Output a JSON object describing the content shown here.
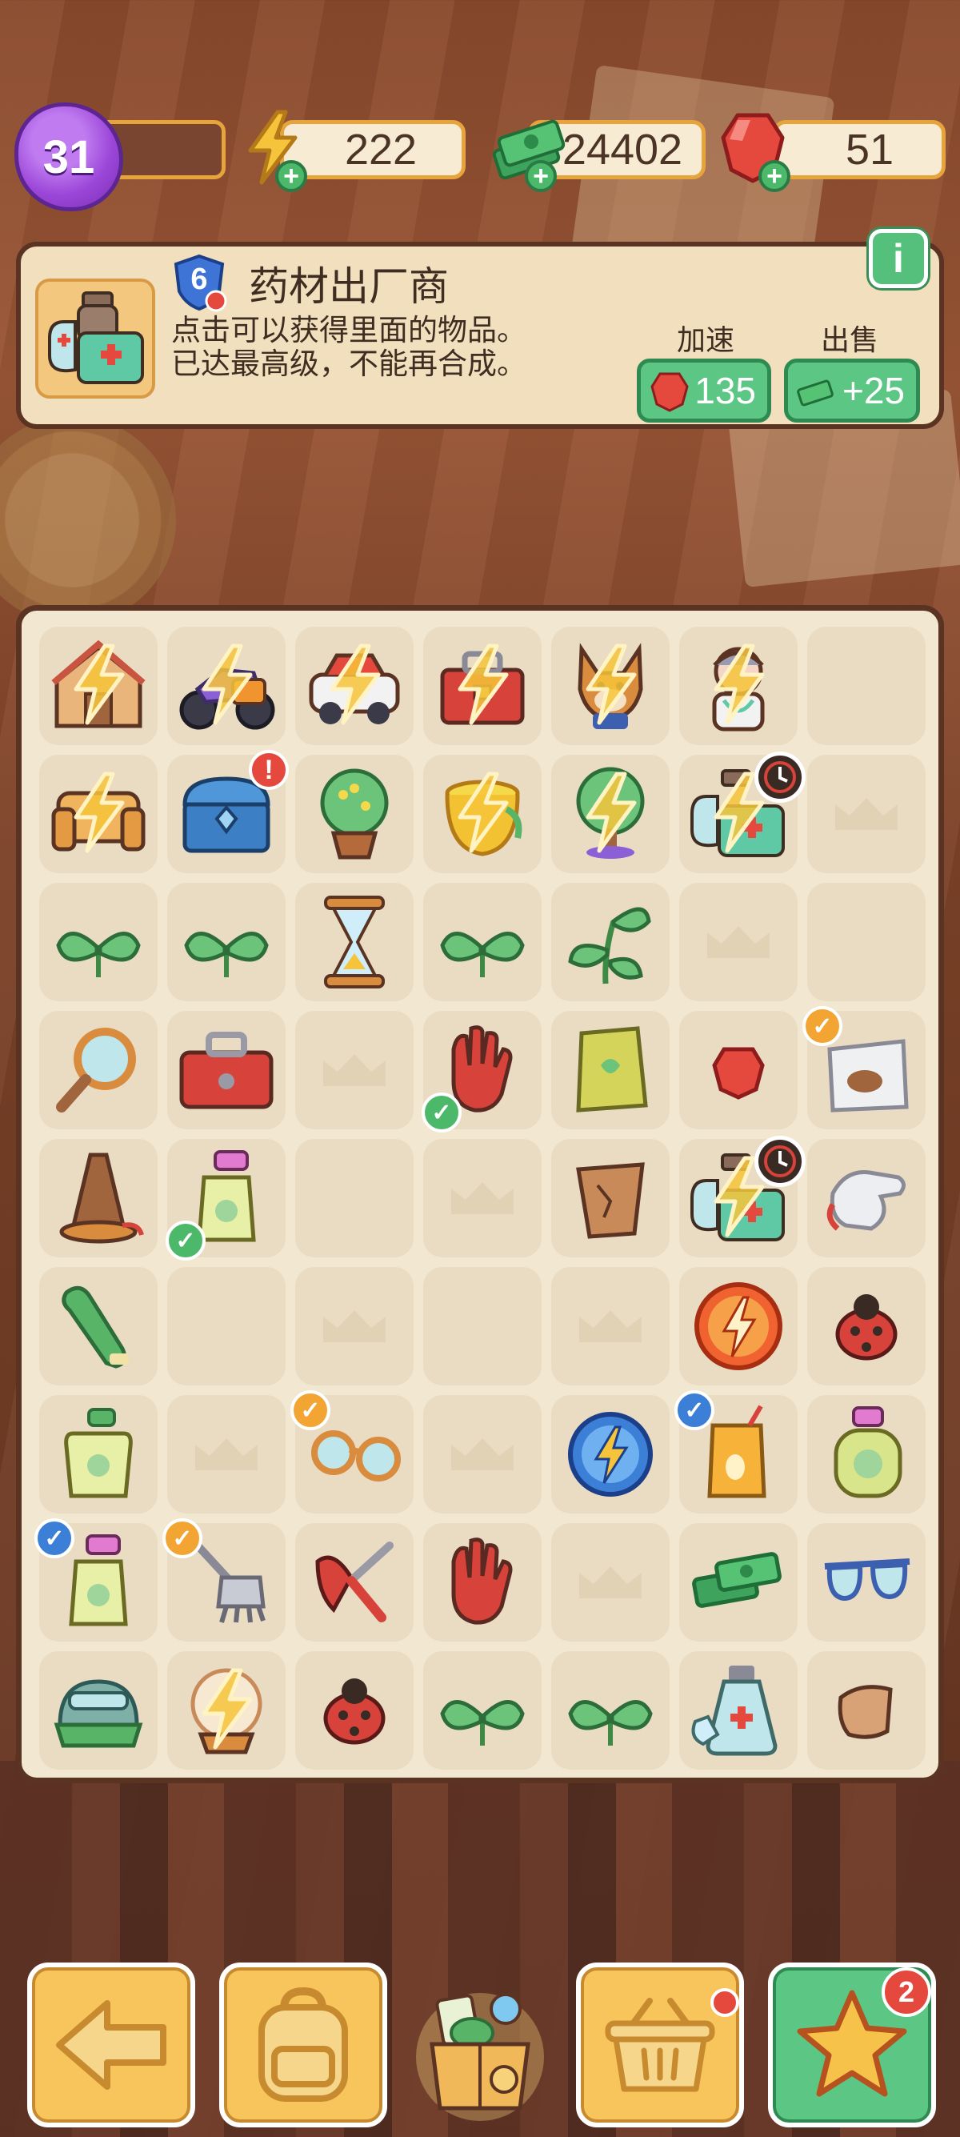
{
  "player": {
    "level": "31"
  },
  "resources": {
    "energy": {
      "value": "222",
      "icon": "lightning-icon",
      "color": "#f6b92c"
    },
    "cash": {
      "value": "24402",
      "icon": "cash-stack-icon",
      "color": "#4cb86a"
    },
    "gems": {
      "value": "51",
      "icon": "ruby-gem-icon",
      "color": "#e03b3b"
    }
  },
  "info_panel": {
    "item_level": "6",
    "title": "药材出厂商",
    "description_line1": "点击可以获得里面的物品。",
    "description_line2": "已达最高级，不能再合成。",
    "speedup_label": "加速",
    "speedup_cost": "135",
    "sell_label": "出售",
    "sell_value": "+25"
  },
  "board": {
    "columns": 7,
    "rows": 9,
    "cells": [
      {
        "item": "house-icon",
        "bolt": true
      },
      {
        "item": "motorcycle-icon",
        "bolt": true
      },
      {
        "item": "car-icon",
        "bolt": true
      },
      {
        "item": "toolbox-icon",
        "bolt": true
      },
      {
        "item": "dog-icon",
        "bolt": true
      },
      {
        "item": "doctor-icon",
        "bolt": true
      },
      {
        "item": ""
      },
      {
        "item": "sofa-icon",
        "bolt": true
      },
      {
        "item": "treasure-chest-icon",
        "alert": "!"
      },
      {
        "item": "potted-tree-icon"
      },
      {
        "item": "golden-pot-icon",
        "bolt": true
      },
      {
        "item": "tree-icon",
        "bolt": true
      },
      {
        "item": "medicine-kit-icon",
        "bolt": true,
        "timer": true
      },
      {
        "item": "",
        "empty_mark": true
      },
      {
        "item": "sprout-icon"
      },
      {
        "item": "sprout-icon"
      },
      {
        "item": "hourglass-icon"
      },
      {
        "item": "sprout-icon"
      },
      {
        "item": "leafy-plant-icon"
      },
      {
        "item": "",
        "empty_mark": true
      },
      {
        "item": ""
      },
      {
        "item": "magnifier-icon"
      },
      {
        "item": "red-toolbox-icon"
      },
      {
        "item": "",
        "empty_mark": true
      },
      {
        "item": "red-glove-icon",
        "check": "green"
      },
      {
        "item": "seed-bag-icon"
      },
      {
        "item": "small-ruby-icon"
      },
      {
        "item": "bag-icon",
        "check": "orange"
      },
      {
        "item": "traffic-cone-icon"
      },
      {
        "item": "spray-bottle-icon",
        "check": "green"
      },
      {
        "item": ""
      },
      {
        "item": "",
        "empty_mark": true
      },
      {
        "item": "broken-pot-icon"
      },
      {
        "item": "medicine-kit-icon",
        "bolt": true,
        "timer": true
      },
      {
        "item": "white-glove-icon"
      },
      {
        "item": "green-glove-icon"
      },
      {
        "item": ""
      },
      {
        "item": "",
        "empty_mark": true
      },
      {
        "item": ""
      },
      {
        "item": "",
        "empty_mark": true
      },
      {
        "item": "energy-orb-orange-icon"
      },
      {
        "item": "ladybug-icon"
      },
      {
        "item": "soap-bottle-icon"
      },
      {
        "item": "",
        "empty_mark": true
      },
      {
        "item": "goggles-icon",
        "check": "orange"
      },
      {
        "item": "",
        "empty_mark": true
      },
      {
        "item": "energy-orb-blue-icon"
      },
      {
        "item": "juice-box-icon",
        "check": "blue"
      },
      {
        "item": "perfume-bottle-icon"
      },
      {
        "item": "spray-bottle-icon",
        "check": "blue"
      },
      {
        "item": "rake-icon",
        "check": "orange"
      },
      {
        "item": "pruning-shears-icon"
      },
      {
        "item": "red-glove-icon"
      },
      {
        "item": "",
        "empty_mark": true
      },
      {
        "item": "cash-stack-icon"
      },
      {
        "item": "sunglasses-icon"
      },
      {
        "item": "helmet-icon"
      },
      {
        "item": "crystal-ball-icon",
        "bolt": true
      },
      {
        "item": "ladybug-icon"
      },
      {
        "item": "sprout-icon"
      },
      {
        "item": "sprout-icon"
      },
      {
        "item": "medicine-bottles-icon"
      },
      {
        "item": "pottery-shard-icon"
      }
    ]
  },
  "bottom_bar": {
    "back": {
      "icon": "back-arrow-icon"
    },
    "backpack": {
      "icon": "backpack-icon"
    },
    "gift": {
      "icon": "gift-box-icon"
    },
    "basket": {
      "icon": "basket-icon",
      "has_dot": true
    },
    "stars": {
      "icon": "star-icon",
      "count": "2"
    }
  }
}
